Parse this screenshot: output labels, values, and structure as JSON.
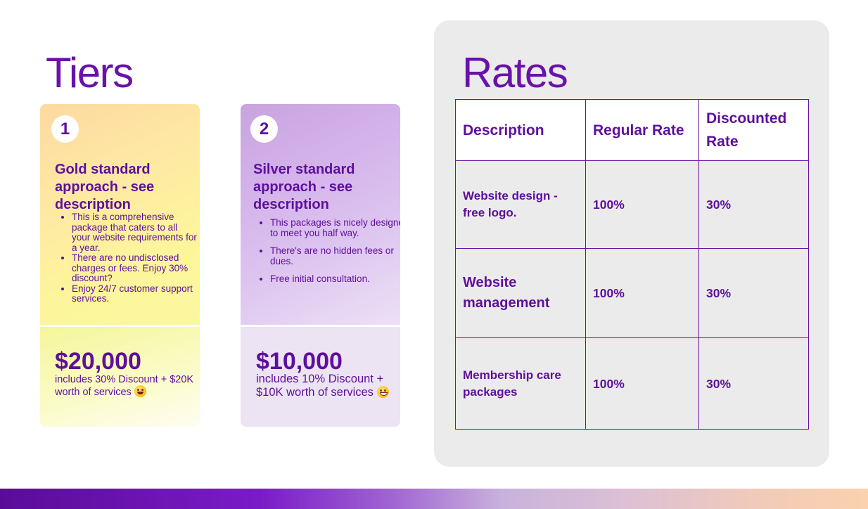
{
  "tiers": {
    "title": "Tiers",
    "cards": [
      {
        "number": "1",
        "heading": "Gold standard approach - see description",
        "bullets": [
          "This is a comprehensive package that caters to all your website requirements for a year.",
          "There are no undisclosed charges or fees. Enjoy 30% discount?",
          "Enjoy 24/7 customer support services."
        ],
        "price": "$20,000",
        "note": "includes 30% Discount + $20K worth of services",
        "emoji": "crazy-face-emoji"
      },
      {
        "number": "2",
        "heading": "Silver standard approach - see description",
        "bullets": [
          "This packages is nicely designed to meet you half way.",
          "There's are no hidden fees or dues.",
          "Free initial consultation."
        ],
        "price": "$10,000",
        "note": "includes 10% Discount + $10K worth of services",
        "emoji": "grinning-face-emoji"
      }
    ]
  },
  "rates": {
    "title": "Rates",
    "headers": [
      "Description",
      "Regular Rate",
      "Discounted Rate"
    ],
    "rows": [
      {
        "description": "Website design - free logo.",
        "regular": "100%",
        "discounted": "30%"
      },
      {
        "description": "Website management",
        "regular": "100%",
        "discounted": "30%"
      },
      {
        "description": "Membership care packages",
        "regular": "100%",
        "discounted": "30%"
      }
    ]
  },
  "colors": {
    "accent_purple": "#5e0f9c",
    "title_purple": "#6a12a8",
    "panel_gray": "#ebebeb"
  }
}
